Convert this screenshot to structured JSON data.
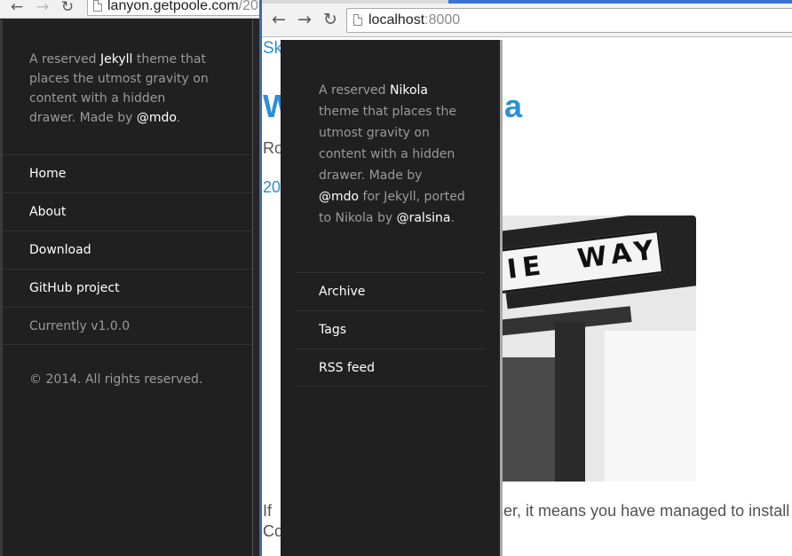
{
  "left_window": {
    "url_main": "lanyon.getpoole.com",
    "url_rest": "/20",
    "sidebar": {
      "about_prefix": "A reserved ",
      "about_link": "Jekyll",
      "about_suffix": " theme that places the utmost gravity on content with a hidden drawer. Made by ",
      "about_author": "@mdo",
      "about_end": ".",
      "nav": [
        "Home",
        "About",
        "Download",
        "GitHub project"
      ],
      "version": "Currently v1.0.0",
      "copyright": "© 2014. All rights reserved."
    }
  },
  "right_window": {
    "url_main": "localhost",
    "url_port": ":8000",
    "page": {
      "skip_link": "Sk",
      "title_left": "W",
      "title_right": "a",
      "meta": "Ro",
      "date": "20",
      "text_line1_left": "If",
      "text_line1_right": "ser, it means you have managed to install",
      "text_line2_left": "Co",
      "photo_sign_left": "IE",
      "photo_sign_right": "WAY"
    },
    "drawer": {
      "about_prefix": "A reserved ",
      "about_link": "Nikola",
      "about_middle": " theme that places the utmost gravity on content with a hidden drawer. Made by ",
      "about_author": "@mdo",
      "about_middle2": " for Jekyll, ported to Nikola by ",
      "about_porter": "@ralsina",
      "about_end": ".",
      "nav": [
        "Archive",
        "Tags",
        "RSS feed"
      ]
    }
  },
  "icons": {
    "back": "back-arrow-icon",
    "forward": "forward-arrow-icon",
    "reload": "reload-icon",
    "page": "page-icon"
  },
  "colors": {
    "sidebar_bg": "#202020",
    "link_blue": "#2a8fd6",
    "muted_text": "#9a9a9a"
  }
}
